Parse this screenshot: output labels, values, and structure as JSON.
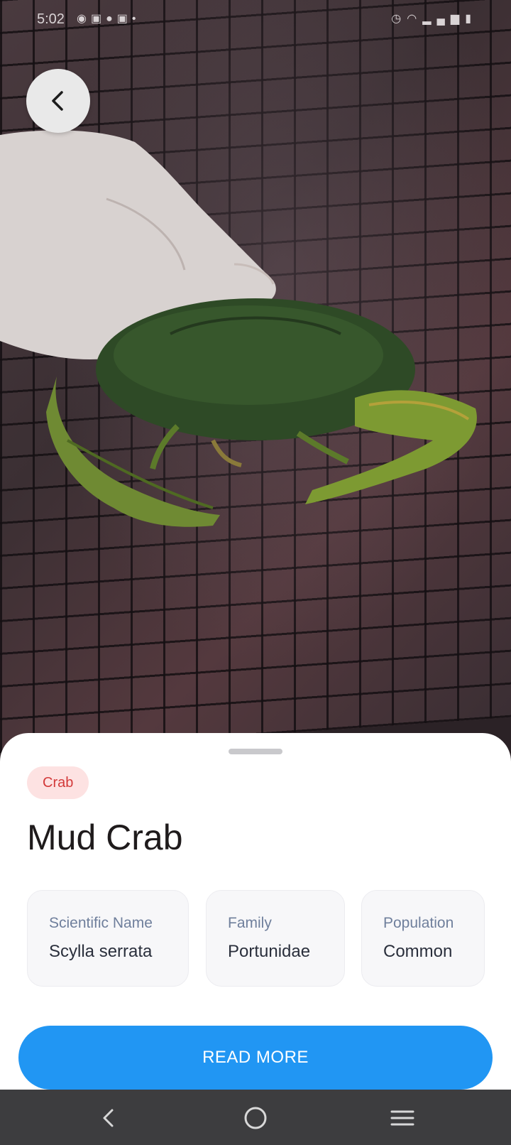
{
  "status_bar": {
    "time": "5:02",
    "left_icons": [
      "messenger-icon",
      "facebook-icon",
      "chat-icon",
      "facebook-icon",
      "dot-icon"
    ],
    "right_icons": [
      "alarm-icon",
      "wifi-icon",
      "signal-icon",
      "battery-icon"
    ]
  },
  "back_button": {
    "icon": "chevron-left-icon"
  },
  "animal": {
    "tag": "Crab",
    "name": "Mud Crab",
    "facts": [
      {
        "label": "Scientific Name",
        "value": "Scylla serrata"
      },
      {
        "label": "Family",
        "value": "Portunidae"
      },
      {
        "label": "Population",
        "value": "Common"
      }
    ]
  },
  "actions": {
    "read_more": "READ MORE"
  },
  "colors": {
    "accent": "#2196f3",
    "tag_bg": "#fde2e2",
    "tag_text": "#d33a3a",
    "nav_bar": "#3d3d3f"
  },
  "nav_bar": {
    "icons": [
      "back-icon",
      "home-icon",
      "recents-icon"
    ]
  }
}
